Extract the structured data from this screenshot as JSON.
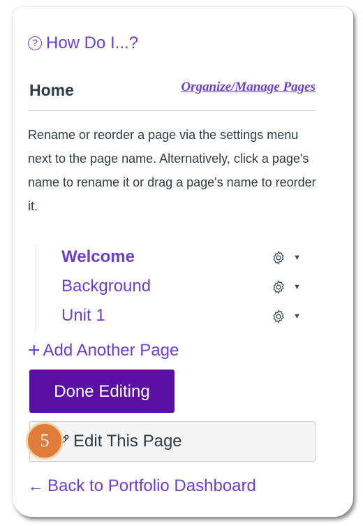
{
  "help": {
    "label": "How Do I...?",
    "icon": "?"
  },
  "header": {
    "title": "Home",
    "organize_link": "Organize/Manage Pages"
  },
  "instructions": "Rename or reorder a page via the settings menu next to the page name. Alternatively, click a page's name to rename it or drag a page's name to reorder it.",
  "pages": [
    {
      "name": "Welcome",
      "current": true
    },
    {
      "name": "Background",
      "current": false
    },
    {
      "name": "Unit 1",
      "current": false
    }
  ],
  "add_page": {
    "label": "Add Another Page",
    "icon": "plus-icon"
  },
  "buttons": {
    "done_editing": "Done Editing",
    "edit_page": "Edit This Page"
  },
  "step_badge": "5",
  "back_link": "Back to Portfolio Dashboard",
  "colors": {
    "link": "#6b3fd1",
    "primary_button": "#5a0fa3",
    "badge": "#e07b39"
  }
}
